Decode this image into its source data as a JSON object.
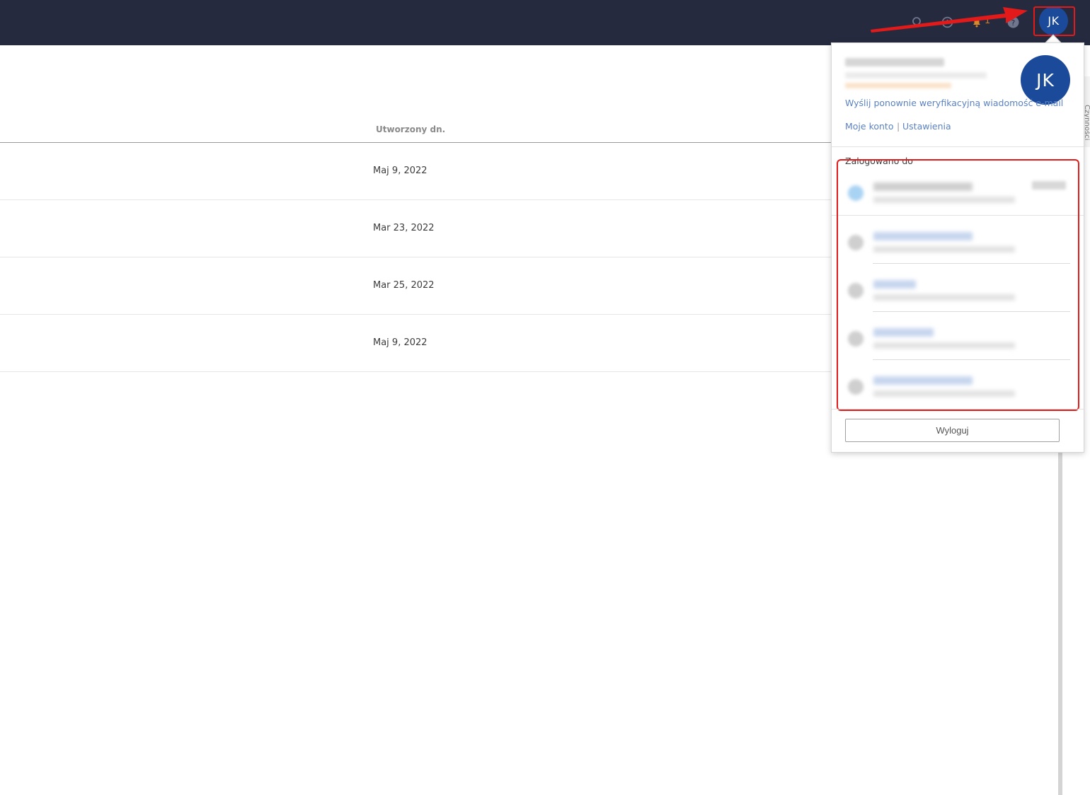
{
  "topbar": {
    "icons": [
      "search-icon",
      "clock-icon",
      "bell-icon",
      "help-icon"
    ],
    "notification_count": "1",
    "avatar_initials": "JK"
  },
  "table": {
    "column_header": "Utworzony dn.",
    "rows": [
      {
        "created": "Maj 9, 2022"
      },
      {
        "created": "Mar 23, 2022"
      },
      {
        "created": "Mar 25, 2022"
      },
      {
        "created": "Maj 9, 2022"
      }
    ]
  },
  "side_panel": {
    "label": "Czynności"
  },
  "profile_menu": {
    "avatar_initials": "JK",
    "resend_verification": "Wyślij ponownie weryfikacyjną wiadomość e-mail",
    "my_account": "Moje konto",
    "separator": "|",
    "settings": "Ustawienia",
    "signed_in_to": "Zalogowano do",
    "logout": "Wyloguj"
  },
  "colors": {
    "topbar_bg": "#252a3f",
    "avatar": "#1c4a9a",
    "link": "#5b82c2",
    "annotation_red": "#e21a1a"
  }
}
